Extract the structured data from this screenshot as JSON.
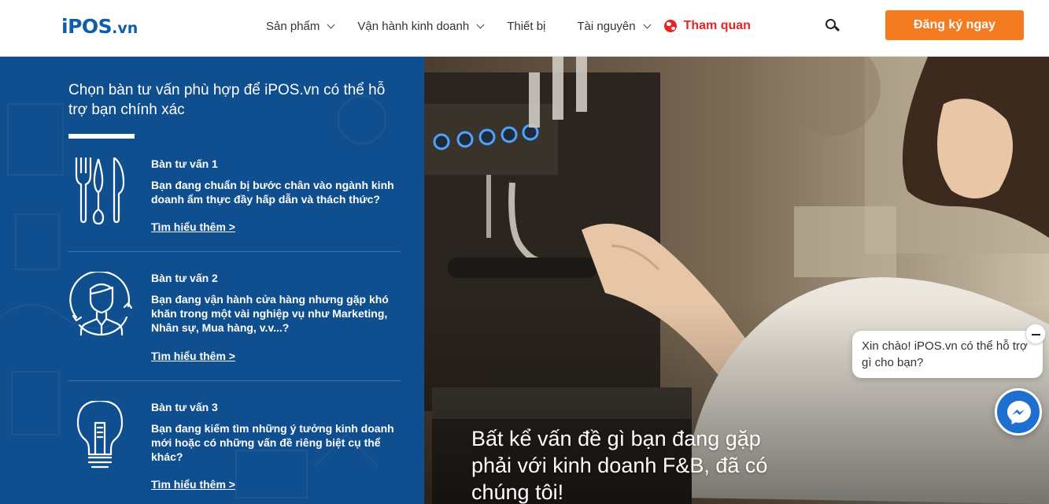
{
  "brand": {
    "logo_main": "iPOS",
    "logo_suffix": ".vn",
    "accent": "#f47b20",
    "primary": "#0f4f8f",
    "highlight": "#e52424"
  },
  "nav": {
    "items": [
      {
        "label": "Sản phẩm"
      },
      {
        "label": "Vận hành kinh doanh"
      },
      {
        "label": "Thiết bị"
      },
      {
        "label": "Tài nguyên"
      }
    ],
    "tour_label": "Tham quan",
    "search_icon": "search-icon",
    "cta_label": "Đăng ký ngay"
  },
  "panel": {
    "title": "Chọn bàn tư vấn phù hợp để iPOS.vn có thể hỗ trợ bạn chính xác",
    "advisors": [
      {
        "label": "Bàn tư vấn 1",
        "description": "Bạn đang chuẩn bị bước chân vào ngành kinh doanh ẩm thực đầy hấp dẫn và thách thức?",
        "link": "Tìm hiểu thêm >",
        "icon": "utensils-icon"
      },
      {
        "label": "Bàn tư vấn 2",
        "description": "Bạn đang vận hành cửa hàng nhưng gặp khó khăn trong một vài nghiệp vụ như Marketing, Nhân sự, Mua hàng, v.v...?",
        "link": "Tìm hiểu thêm >",
        "icon": "person-icon"
      },
      {
        "label": "Bàn tư vấn 3",
        "description": "Bạn đang kiếm tìm những ý tưởng kinh doanh mới hoặc có những vấn đề riêng biệt cụ thể khác?",
        "link": "Tìm hiểu thêm >",
        "icon": "lightbulb-icon"
      }
    ]
  },
  "hero": {
    "headline": "Bất kể vấn đề gì bạn đang gặp phải với kinh doanh F&B, đã có chúng tôi!"
  },
  "chat": {
    "message": "Xin chào! iPOS.vn có thể hỗ trợ gì cho bạn?",
    "messenger_icon": "messenger-icon",
    "close_icon": "minimize-icon"
  }
}
